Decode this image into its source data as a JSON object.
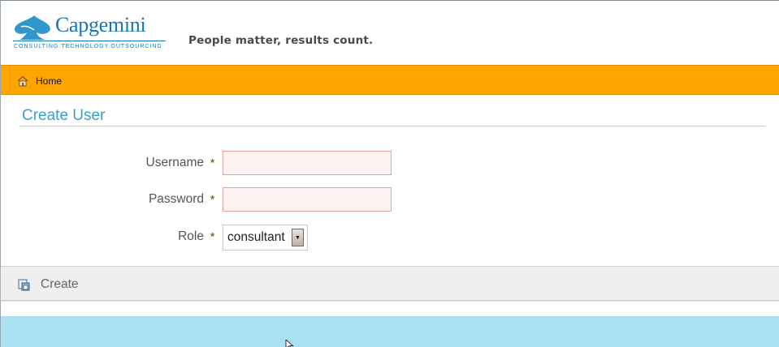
{
  "header": {
    "logo_text": "Capgemini",
    "logo_subtext": "CONSULTING.TECHNOLOGY.OUTSOURCING",
    "tagline": "People matter, results count."
  },
  "nav": {
    "home_icon": "home-icon",
    "home_label": "Home"
  },
  "page": {
    "title": "Create User"
  },
  "form": {
    "username_label": "Username",
    "password_label": "Password",
    "role_label": "Role",
    "required_marker": "*",
    "username_value": "",
    "password_value": "",
    "role_selected": "consultant"
  },
  "actions": {
    "create_icon": "create-user-icon",
    "create_label": "Create"
  },
  "colors": {
    "nav_bar": "#ffa500",
    "title": "#3aa0c8",
    "brand_blue": "#1478b8",
    "footer_band": "#abe0f3",
    "required_input_bg": "#fff2f2"
  }
}
